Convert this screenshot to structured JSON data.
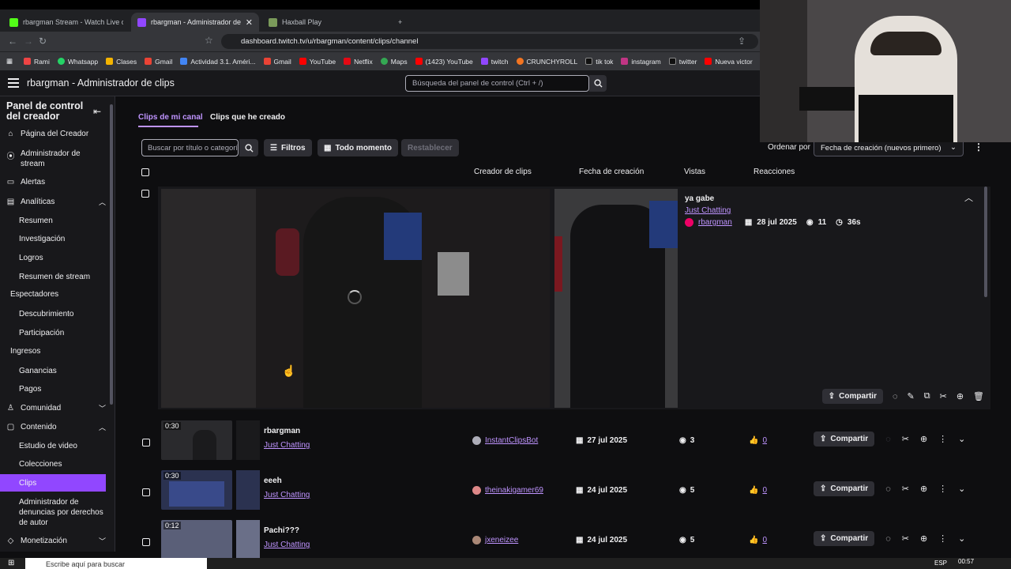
{
  "browser": {
    "tabs": [
      {
        "title": "rbargman Stream - Watch Live on Ki",
        "color": "#53fc18"
      },
      {
        "title": "rbargman - Administrador de cli",
        "color": "#9147ff"
      },
      {
        "title": "Haxball Play",
        "color": "#7a9a5a"
      }
    ],
    "url": "dashboard.twitch.tv/u/rbargman/content/clips/channel",
    "bookmarks": [
      {
        "label": "Rami",
        "color": "#e44"
      },
      {
        "label": "Whatsapp",
        "color": "#25d366"
      },
      {
        "label": "Clases",
        "color": "#f4b400"
      },
      {
        "label": "Gmail",
        "color": "#ea4335"
      },
      {
        "label": "Actividad 3.1. Améri...",
        "color": "#4285f4"
      },
      {
        "label": "Gmail",
        "color": "#ea4335"
      },
      {
        "label": "YouTube",
        "color": "#ff0000"
      },
      {
        "label": "Netflix",
        "color": "#e50914"
      },
      {
        "label": "Maps",
        "color": "#34a853"
      },
      {
        "label": "(1423) YouTube",
        "color": "#ff0000"
      },
      {
        "label": "twitch",
        "color": "#9147ff"
      },
      {
        "label": "CRUNCHYROLL",
        "color": "#f47521"
      },
      {
        "label": "tik tok",
        "color": "#000"
      },
      {
        "label": "instagram",
        "color": "#c13584"
      },
      {
        "label": "twitter",
        "color": "#000"
      },
      {
        "label": "Nueva victor",
        "color": "#ff0000"
      }
    ]
  },
  "header": {
    "title": "rbargman - Administrador de clips",
    "search_placeholder": "Búsqueda del panel de control (Ctrl + /)"
  },
  "sidebar": {
    "title": "Panel de control del creador",
    "items": {
      "home": "Página del Creador",
      "stream_manager": "Administrador de stream",
      "alerts": "Alertas",
      "analytics": "Analíticas",
      "summary": "Resumen",
      "research": "Investigación",
      "achievements": "Logros",
      "stream_summary": "Resumen de stream",
      "viewers": "Espectadores",
      "discovery": "Descubrimiento",
      "participation": "Participación",
      "revenue": "Ingresos",
      "earnings": "Ganancias",
      "payments": "Pagos",
      "community": "Comunidad",
      "content": "Contenido",
      "video_studio": "Estudio de video",
      "collections": "Colecciones",
      "clips": "Clips",
      "copyright": "Administrador de denuncias por derechos de autor",
      "monetization": "Monetización"
    }
  },
  "main": {
    "tabs": {
      "mine": "Clips de mi canal",
      "created": "Clips que he creado"
    },
    "filter": {
      "search_placeholder": "Buscar por título o categoría",
      "filters": "Filtros",
      "time": "Todo momento",
      "reset": "Restablecer",
      "sort_label": "Ordenar por",
      "sort_value": "Fecha de creación (nuevos primero)"
    },
    "columns": {
      "creator": "Creador de clips",
      "date": "Fecha de creación",
      "views": "Vistas",
      "reactions": "Reacciones"
    },
    "expanded": {
      "title": "ya gabe",
      "category": "Just Chatting",
      "creator": "rbargman",
      "date": "28 jul 2025",
      "views": "11",
      "duration": "36s",
      "share": "Compartir"
    },
    "rows": [
      {
        "duration": "0:30",
        "title": "rbargman",
        "category": "Just Chatting",
        "creator": "InstantClipsBot",
        "date": "27 jul 2025",
        "views": "3",
        "reactions": "0",
        "share": "Compartir"
      },
      {
        "duration": "0:30",
        "title": "eeeh",
        "category": "Just Chatting",
        "creator": "theinakigamer69",
        "date": "24 jul 2025",
        "views": "5",
        "reactions": "0",
        "share": "Compartir"
      },
      {
        "duration": "0:12",
        "title": "Pachi???",
        "category": "Just Chatting",
        "creator": "jxeneizee",
        "date": "24 jul 2025",
        "views": "5",
        "reactions": "0",
        "share": "Compartir"
      }
    ]
  },
  "taskbar": {
    "search_placeholder": "Escribe aquí para buscar",
    "time": "00:57",
    "lang": "ESP"
  }
}
